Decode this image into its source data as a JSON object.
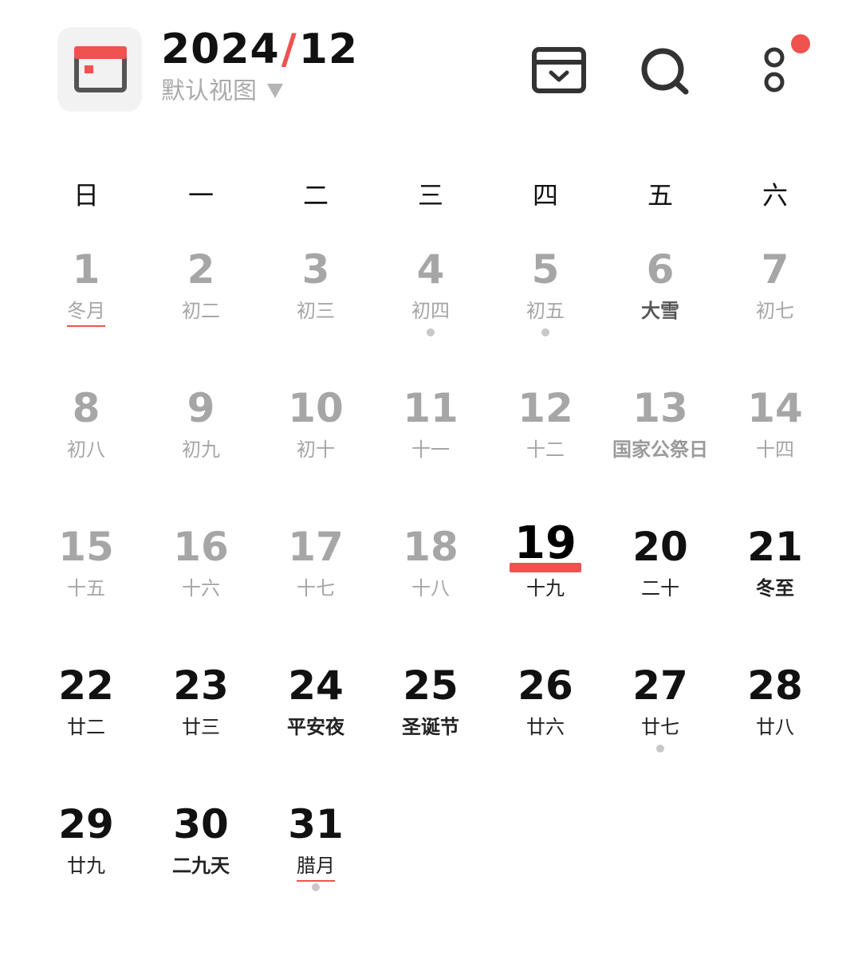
{
  "header": {
    "year": "2024",
    "separator": "/",
    "month": "12",
    "view_label": "默认视图",
    "accent_color": "#f0524f"
  },
  "weekdays": [
    "日",
    "一",
    "二",
    "三",
    "四",
    "五",
    "六"
  ],
  "days": [
    {
      "day": "1",
      "lunar": "冬月",
      "state": "past",
      "month_start": true
    },
    {
      "day": "2",
      "lunar": "初二",
      "state": "past"
    },
    {
      "day": "3",
      "lunar": "初三",
      "state": "past"
    },
    {
      "day": "4",
      "lunar": "初四",
      "state": "past",
      "dot": true
    },
    {
      "day": "5",
      "lunar": "初五",
      "state": "past",
      "dot": true
    },
    {
      "day": "6",
      "lunar": "大雪",
      "state": "past",
      "solar_term": true
    },
    {
      "day": "7",
      "lunar": "初七",
      "state": "past"
    },
    {
      "day": "8",
      "lunar": "初八",
      "state": "past"
    },
    {
      "day": "9",
      "lunar": "初九",
      "state": "past"
    },
    {
      "day": "10",
      "lunar": "初十",
      "state": "past"
    },
    {
      "day": "11",
      "lunar": "十一",
      "state": "past"
    },
    {
      "day": "12",
      "lunar": "十二",
      "state": "past"
    },
    {
      "day": "13",
      "lunar": "国家公祭日",
      "state": "past",
      "festival": true
    },
    {
      "day": "14",
      "lunar": "十四",
      "state": "past"
    },
    {
      "day": "15",
      "lunar": "十五",
      "state": "past"
    },
    {
      "day": "16",
      "lunar": "十六",
      "state": "past"
    },
    {
      "day": "17",
      "lunar": "十七",
      "state": "past"
    },
    {
      "day": "18",
      "lunar": "十八",
      "state": "past"
    },
    {
      "day": "19",
      "lunar": "十九",
      "state": "today"
    },
    {
      "day": "20",
      "lunar": "二十",
      "state": "future"
    },
    {
      "day": "21",
      "lunar": "冬至",
      "state": "future",
      "festival": true
    },
    {
      "day": "22",
      "lunar": "廿二",
      "state": "future"
    },
    {
      "day": "23",
      "lunar": "廿三",
      "state": "future"
    },
    {
      "day": "24",
      "lunar": "平安夜",
      "state": "future",
      "festival": true
    },
    {
      "day": "25",
      "lunar": "圣诞节",
      "state": "future",
      "festival": true
    },
    {
      "day": "26",
      "lunar": "廿六",
      "state": "future"
    },
    {
      "day": "27",
      "lunar": "廿七",
      "state": "future",
      "dot": true
    },
    {
      "day": "28",
      "lunar": "廿八",
      "state": "future"
    },
    {
      "day": "29",
      "lunar": "廿九",
      "state": "future"
    },
    {
      "day": "30",
      "lunar": "二九天",
      "state": "future",
      "festival": true
    },
    {
      "day": "31",
      "lunar": "腊月",
      "state": "future",
      "month_start": true,
      "dot": true
    }
  ],
  "icons": {
    "app": "calendar-app-icon",
    "today": "jump-to-today-icon",
    "search": "search-icon",
    "more": "more-options-icon"
  }
}
